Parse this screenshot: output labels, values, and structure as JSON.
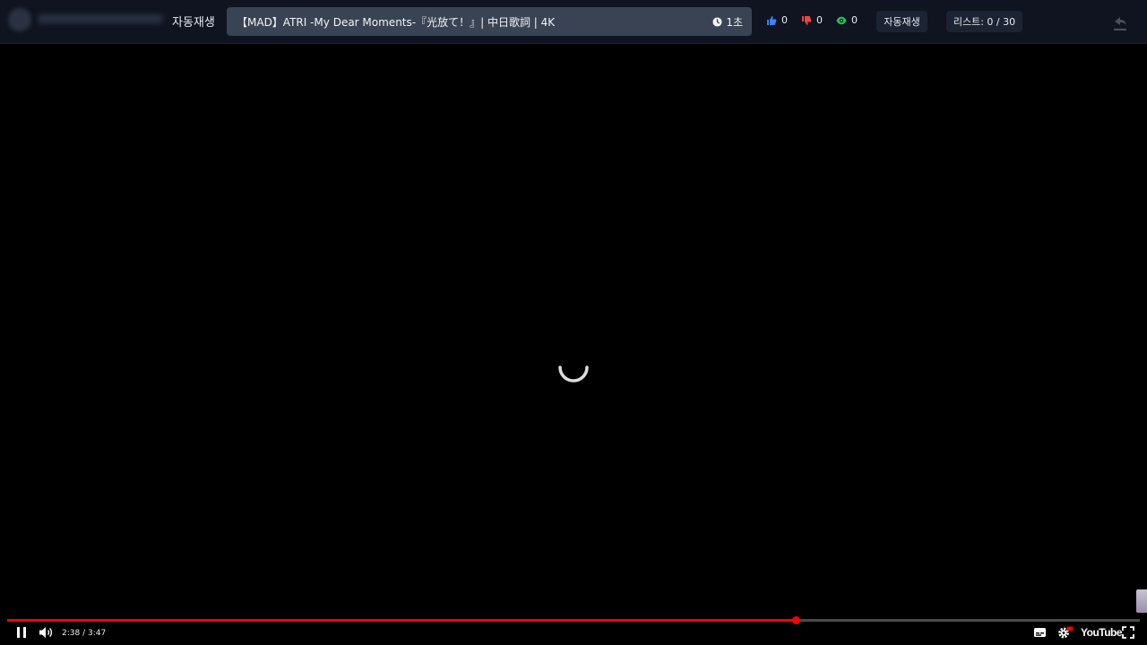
{
  "topbar": {
    "autoplay_label": "자동재생",
    "title": "【MAD】ATRI -My Dear Moments-『光放て！』| 中日歌詞 | 4K",
    "duration": "1초",
    "likes": "0",
    "dislikes": "0",
    "views": "0",
    "autoplay_button": "자동재생",
    "list_button": "리스트: 0 / 30"
  },
  "player": {
    "time_display": "2:38 / 3:47",
    "progress_fraction": 0.696,
    "logo_text": "YouTube",
    "accent_color": "#ff0000"
  },
  "colors": {
    "like": "#3b82f6",
    "dislike": "#ef4444",
    "views": "#22c55e"
  }
}
